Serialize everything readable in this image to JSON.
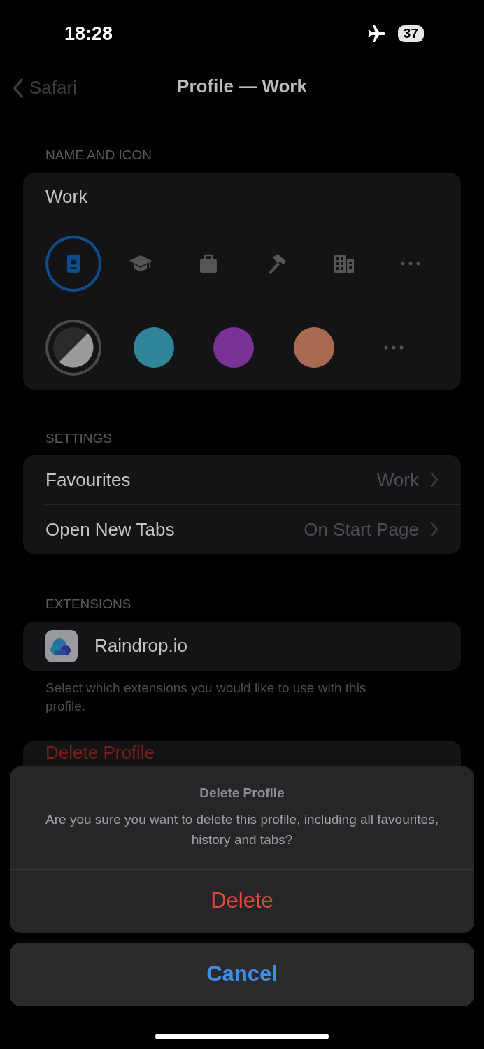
{
  "status_bar": {
    "time": "18:28",
    "battery": "37"
  },
  "nav": {
    "back": "Safari",
    "title": "Profile — Work"
  },
  "name_and_icon": {
    "header": "NAME AND ICON",
    "name": "Work",
    "icons": [
      {
        "kind": "badge",
        "selected": true
      },
      {
        "kind": "graduation",
        "selected": false
      },
      {
        "kind": "bag",
        "selected": false
      },
      {
        "kind": "hammer",
        "selected": false
      },
      {
        "kind": "building",
        "selected": false
      },
      {
        "kind": "more",
        "selected": false
      }
    ],
    "colors": [
      {
        "kind": "split",
        "selected": true
      },
      {
        "kind": "swatch",
        "color": "#2f8597",
        "selected": false
      },
      {
        "kind": "swatch",
        "color": "#7a3296",
        "selected": false
      },
      {
        "kind": "swatch",
        "color": "#a86a50",
        "selected": false
      },
      {
        "kind": "more",
        "selected": false
      }
    ]
  },
  "settings": {
    "header": "SETTINGS",
    "rows": [
      {
        "label": "Favourites",
        "value": "Work"
      },
      {
        "label": "Open New Tabs",
        "value": "On Start Page"
      }
    ]
  },
  "extensions": {
    "header": "EXTENSIONS",
    "items": [
      {
        "name": "Raindrop.io"
      }
    ],
    "footer": "Select which extensions you would like to use with this profile."
  },
  "delete_row": {
    "label": "Delete Profile"
  },
  "action_sheet": {
    "title": "Delete Profile",
    "message": "Are you sure you want to delete this profile, including all favourites, history and tabs?",
    "destructive": "Delete",
    "cancel": "Cancel"
  }
}
